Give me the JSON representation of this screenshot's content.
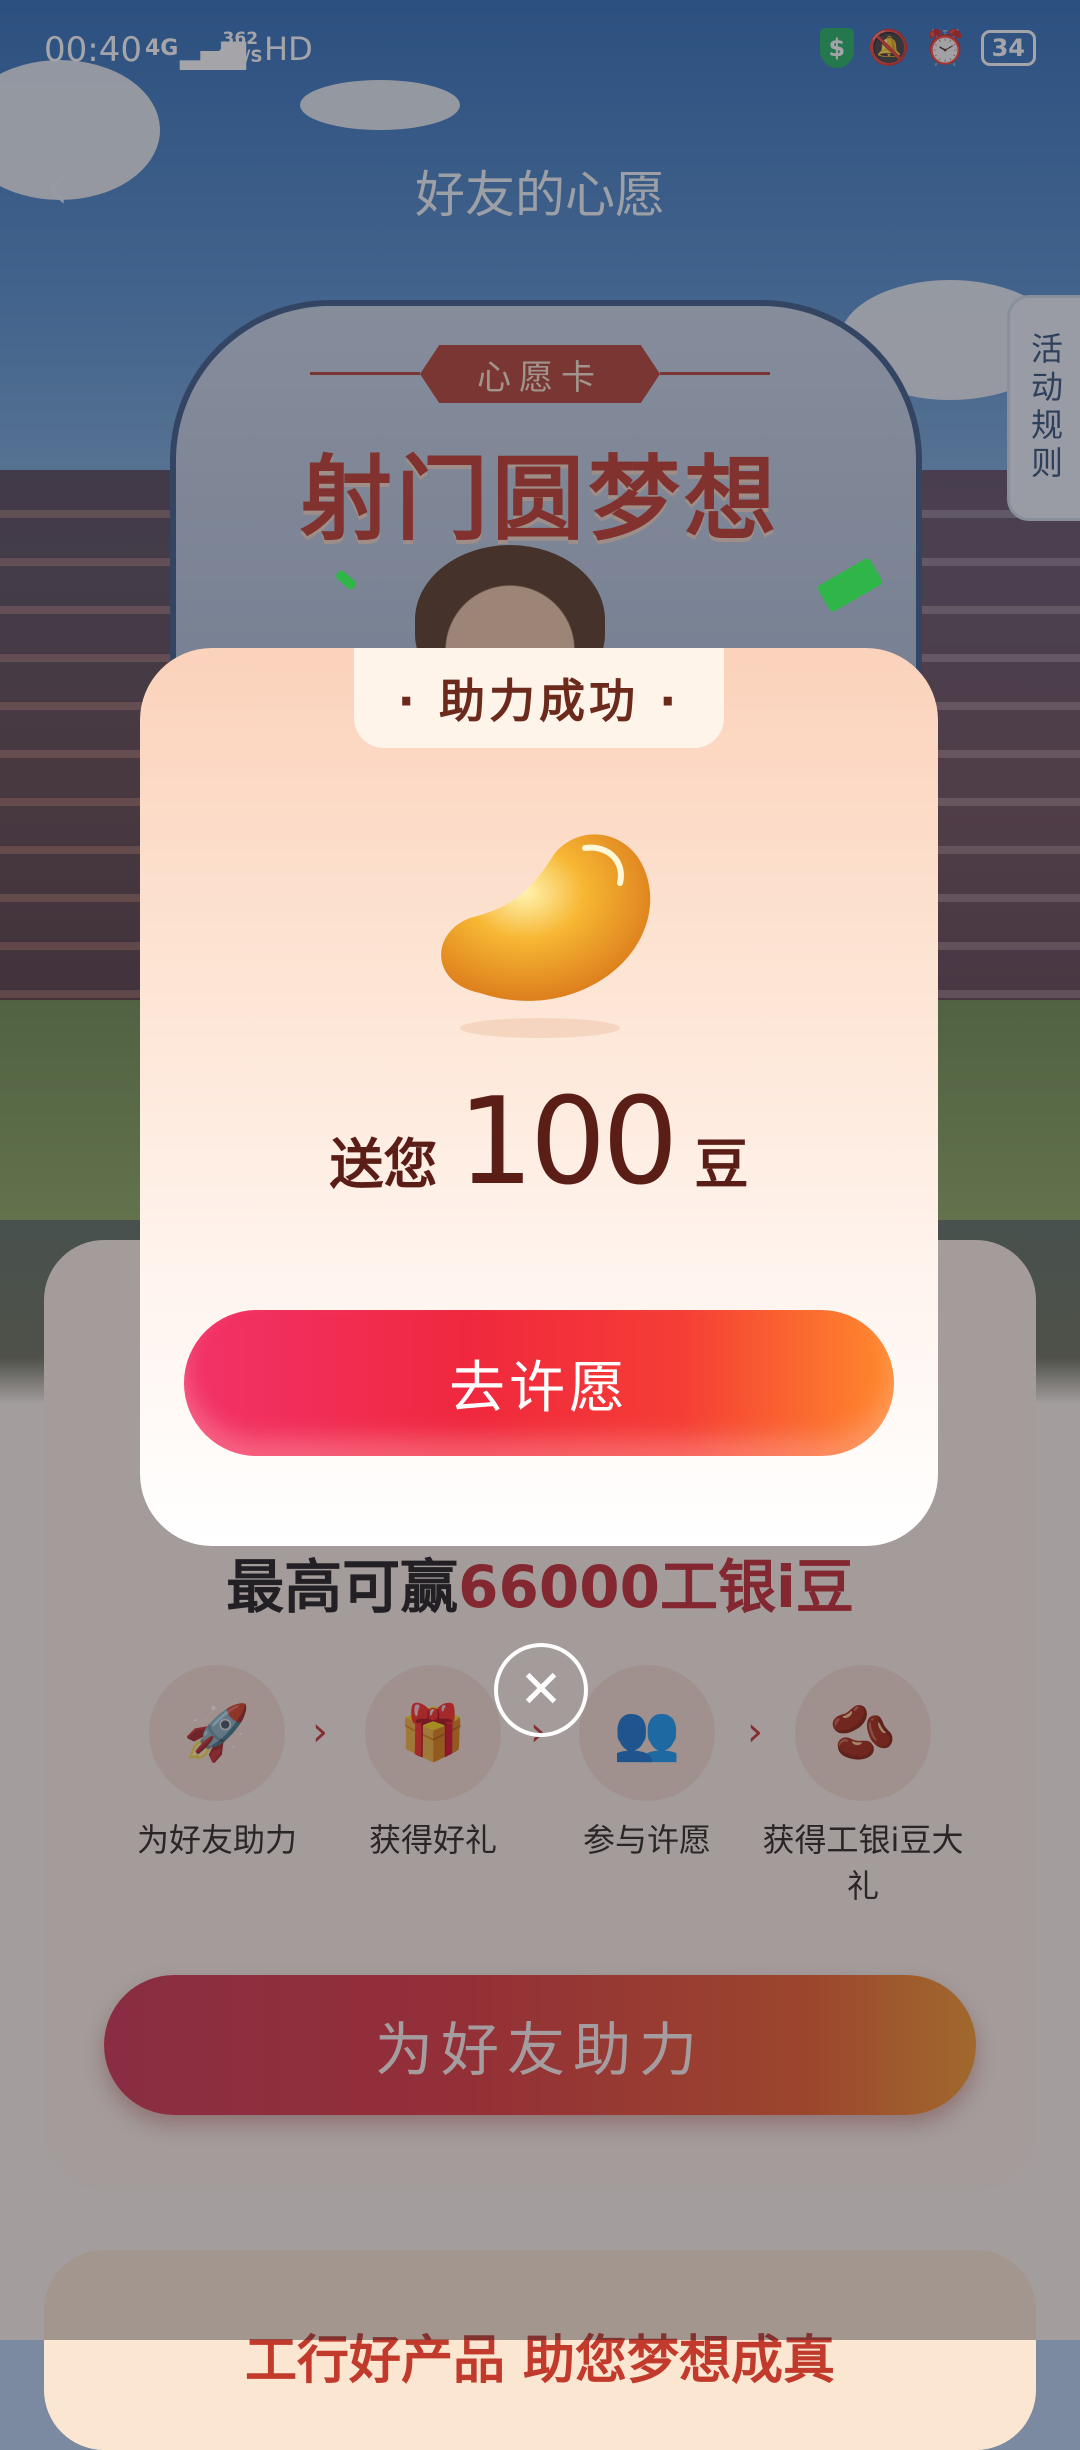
{
  "status": {
    "time": "00:40",
    "network": "4G",
    "speed_value": "362",
    "speed_unit": "KB/S",
    "hd": "HD",
    "battery": "34",
    "icons": [
      "shield-dollar-icon",
      "bell-muted-icon",
      "alarm-icon",
      "battery-icon"
    ]
  },
  "header": {
    "title": "好友的心愿",
    "rules": "活动规则"
  },
  "background": {
    "card_tag": "心愿卡",
    "dream_title": "射门圆梦想",
    "max_prefix": "最高可赢",
    "max_highlight": "66000工银i豆",
    "steps": [
      {
        "label": "为好友助力",
        "icon": "rocket-icon"
      },
      {
        "label": "获得好礼",
        "icon": "gift-icon"
      },
      {
        "label": "参与许愿",
        "icon": "people-icon"
      },
      {
        "label": "获得工银i豆大礼",
        "icon": "bean-icon"
      }
    ],
    "help_button": "为好友助力",
    "bottom_banner": "工行好产品 助您梦想成真"
  },
  "modal": {
    "tab": "· 助力成功 ·",
    "gift_prefix": "送您",
    "gift_amount": "100",
    "gift_unit": "豆",
    "wish_button": "去许愿"
  },
  "colors": {
    "accent_red": "#c4262f",
    "button_gradient_start": "#f2326a",
    "button_gradient_end": "#ff8a2c"
  }
}
